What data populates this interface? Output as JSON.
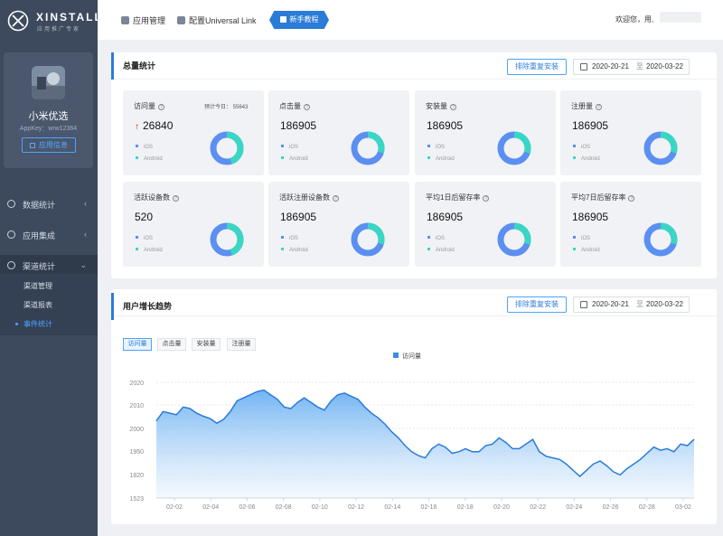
{
  "brand": {
    "name": "XINSTALL",
    "tagline": "应用推广专家"
  },
  "profile": {
    "app_name": "小米优选",
    "app_key": "AppKey：wrw12364",
    "info_button": "应用信息"
  },
  "nav": {
    "items": [
      {
        "label": "数据统计",
        "icon": "chart-icon",
        "chevron": "‹"
      },
      {
        "label": "应用集成",
        "icon": "gear-icon",
        "chevron": "‹"
      },
      {
        "label": "渠道统计",
        "icon": "channel-icon",
        "chevron": "⌄"
      }
    ],
    "sub_items": [
      {
        "label": "渠道管理"
      },
      {
        "label": "渠道报表"
      },
      {
        "label": "事件统计",
        "active": true
      }
    ]
  },
  "topbar": {
    "links": [
      "应用管理",
      "配置Universal Link"
    ],
    "tutorial": "新手教程",
    "welcome": "欢迎您，用,"
  },
  "summary": {
    "title": "总量统计",
    "dedupe_label": "排除重复安装",
    "date_from": "2020-20-21",
    "date_sep": "至",
    "date_to": "2020-03-22",
    "legend": [
      "iOS",
      "Android"
    ],
    "cards": [
      {
        "label": "访问量",
        "value": "26840",
        "today": "预计今日： 55643",
        "trend": "↑",
        "ios": 0.55
      },
      {
        "label": "点击量",
        "value": "186905",
        "ios": 0.7
      },
      {
        "label": "安装量",
        "value": "186905",
        "ios": 0.7
      },
      {
        "label": "注册量",
        "value": "186905",
        "ios": 0.7
      },
      {
        "label": "活跃设备数",
        "value": "520",
        "ios": 0.55
      },
      {
        "label": "活跃注册设备数",
        "value": "186905",
        "ios": 0.7
      },
      {
        "label": "平均1日后留存率",
        "value": "186905",
        "ios": 0.7
      },
      {
        "label": "平均7日后留存率",
        "value": "186905",
        "ios": 0.7
      }
    ]
  },
  "trend": {
    "title": "用户增长趋势",
    "dedupe_label": "排除重复安装",
    "date_from": "2020-20-21",
    "date_sep": "至",
    "date_to": "2020-03-22",
    "tabs": [
      "访问量",
      "点击量",
      "安装量",
      "注册量"
    ],
    "active_tab": 0
  },
  "colors": {
    "accent": "#2b7bd9",
    "ios": "#5b8ff2",
    "android": "#3ad6c4",
    "up": "#e3261c"
  },
  "chart_data": {
    "type": "area",
    "legend": [
      "访问量"
    ],
    "series": [
      {
        "name": "访问量",
        "values": [
          2000,
          2012,
          2010,
          2008,
          2018,
          2016,
          2010,
          2006,
          2003,
          1997,
          2002,
          2012,
          2026,
          2030,
          2034,
          2038,
          2040,
          2034,
          2028,
          2018,
          2016,
          2024,
          2030,
          2024,
          2018,
          2014,
          2026,
          2034,
          2036,
          2032,
          2028,
          2018,
          2010,
          2004,
          1996,
          1986,
          1978,
          1968,
          1960,
          1955,
          1952,
          1964,
          1970,
          1966,
          1958,
          1960,
          1964,
          1960,
          1960,
          1968,
          1970,
          1978,
          1972,
          1964,
          1964,
          1970,
          1976,
          1960,
          1954,
          1952,
          1950,
          1944,
          1936,
          1928,
          1936,
          1944,
          1948,
          1942,
          1934,
          1930,
          1938,
          1944,
          1950,
          1958,
          1966,
          1962,
          1964,
          1960,
          1970,
          1968,
          1976
        ]
      }
    ],
    "x_labels": [
      "02-02",
      "02-04",
      "02-06",
      "02-08",
      "02-10",
      "02-12",
      "02-14",
      "02-16",
      "02-18",
      "02-20",
      "02-22",
      "02-24",
      "02-26",
      "02-28",
      "03-02"
    ],
    "y_ticks": [
      1523,
      1820,
      1950,
      2000,
      2010,
      2020
    ],
    "grid": true
  }
}
